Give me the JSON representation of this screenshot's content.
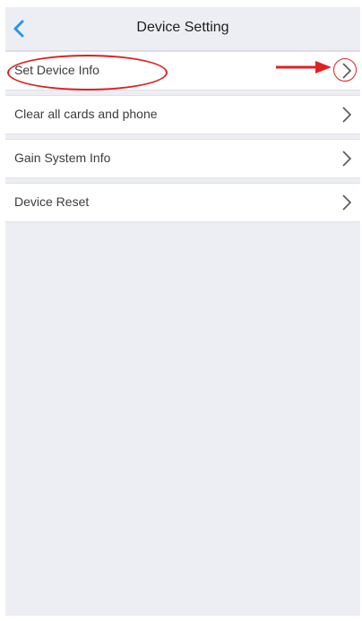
{
  "header": {
    "title": "Device Setting",
    "back_icon": "chevron-left-icon",
    "accent_color": "#2196f3"
  },
  "menu": {
    "items": [
      {
        "label": "Set Device Info",
        "icon": "chevron-right-icon"
      },
      {
        "label": "Clear all cards and phone",
        "icon": "chevron-right-icon"
      },
      {
        "label": "Gain System Info",
        "icon": "chevron-right-icon"
      },
      {
        "label": "Device Reset",
        "icon": "chevron-right-icon"
      }
    ]
  },
  "annotation": {
    "color": "#e02020",
    "highlighted_item": "Clear all cards and phone"
  }
}
